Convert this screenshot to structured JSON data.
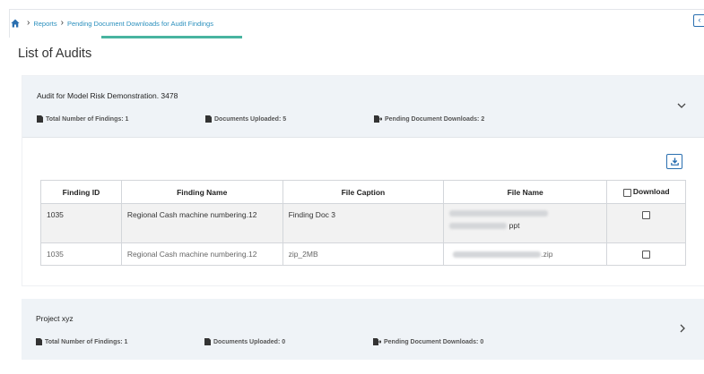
{
  "breadcrumb": {
    "items": [
      "Reports",
      "Pending Document Downloads for Audit Findings"
    ]
  },
  "page_title": "List of Audits",
  "audits": [
    {
      "title": "Audit for Model Risk Demonstration. 3478",
      "stats": {
        "total_findings": "Total Number of Findings: 1",
        "docs_uploaded": "Documents Uploaded: 5",
        "pending_downloads": "Pending Document Downloads: 2"
      },
      "table": {
        "headers": [
          "Finding ID",
          "Finding Name",
          "File Caption",
          "File Name",
          "Download"
        ],
        "rows": [
          {
            "finding_id": "1035",
            "finding_name": "Regional Cash machine numbering.12",
            "file_caption": "Finding Doc 3",
            "file_name_suffix": "ppt"
          },
          {
            "finding_id": "1035",
            "finding_name": "Regional Cash machine numbering.12",
            "file_caption": "zip_2MB",
            "file_name_suffix": ".zip"
          }
        ]
      }
    },
    {
      "title": "Project xyz",
      "stats": {
        "total_findings": "Total Number of Findings: 1",
        "docs_uploaded": "Documents Uploaded: 0",
        "pending_downloads": "Pending Document Downloads: 0"
      }
    }
  ],
  "icons": {
    "home": "home-icon",
    "download": "download-icon",
    "chevron_down": "chevron-down-icon",
    "chevron_right": "chevron-right-icon",
    "collapse": "chevron-left-icon"
  },
  "colors": {
    "link": "#2a8fbd",
    "accent": "#48b4a0",
    "button": "#2a6fb0",
    "card_header": "#eff3f7"
  }
}
